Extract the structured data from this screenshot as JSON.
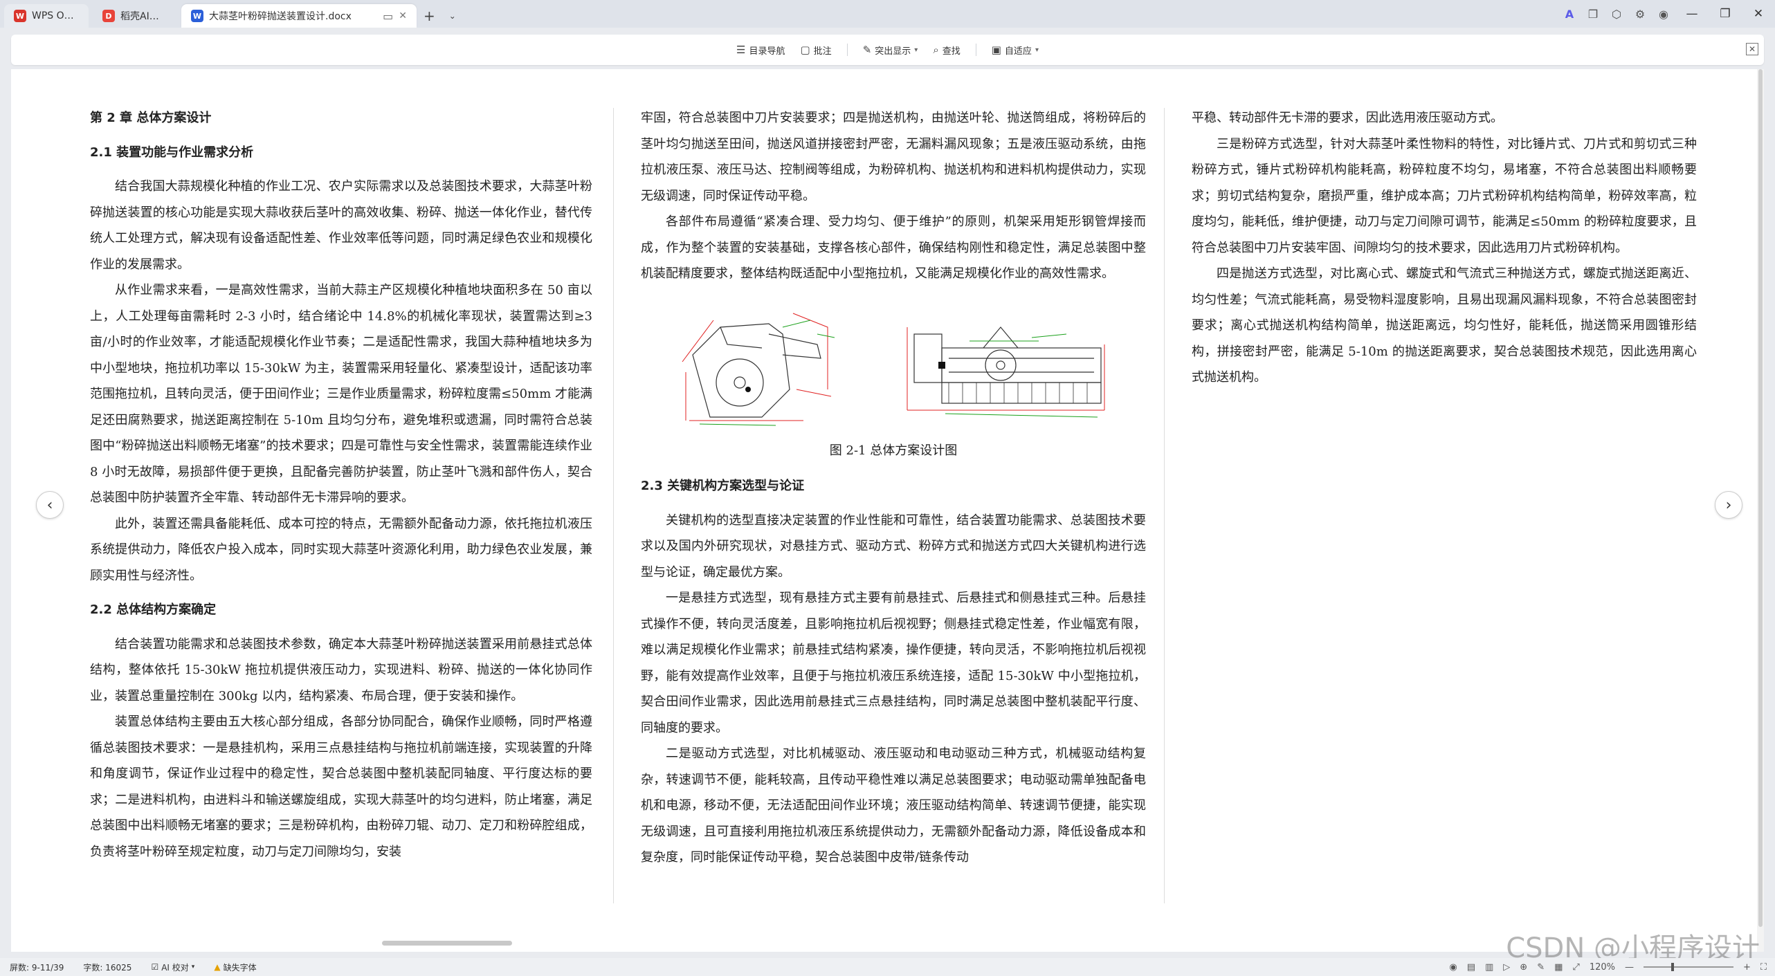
{
  "tabs": [
    {
      "label": "WPS Office",
      "logo_text": "W",
      "logo_color": "#d9342b"
    },
    {
      "label": "稻壳AI模板",
      "logo_text": "D",
      "logo_color": "#e8443a"
    },
    {
      "label": "大蒜茎叶粉碎抛送装置设计.docx",
      "logo_text": "W",
      "logo_color": "#2b5fd9"
    }
  ],
  "toolbar": {
    "nav_label": "目录导航",
    "comment_label": "批注",
    "highlight_label": "突出显示",
    "find_label": "查找",
    "fit_label": "自适应"
  },
  "doc": {
    "ch_title": "第 2 章  总体方案设计",
    "s21_title": "2.1  装置功能与作业需求分析",
    "p1": "结合我国大蒜规模化种植的作业工况、农户实际需求以及总装图技术要求，大蒜茎叶粉碎抛送装置的核心功能是实现大蒜收获后茎叶的高效收集、粉碎、抛送一体化作业，替代传统人工处理方式，解决现有设备适配性差、作业效率低等问题，同时满足绿色农业和规模化作业的发展需求。",
    "p2": "从作业需求来看，一是高效性需求，当前大蒜主产区规模化种植地块面积多在 50 亩以上，人工处理每亩需耗时 2-3 小时，结合绪论中 14.8%的机械化率现状，装置需达到≥3 亩/小时的作业效率，才能适配规模化作业节奏；二是适配性需求，我国大蒜种植地块多为中小型地块，拖拉机功率以 15-30kW 为主，装置需采用轻量化、紧凑型设计，适配该功率范围拖拉机，且转向灵活，便于田间作业；三是作业质量需求，粉碎粒度需≤50mm 才能满足还田腐熟要求，抛送距离控制在 5-10m 且均匀分布，避免堆积或遗漏，同时需符合总装图中“粉碎抛送出料顺畅无堵塞”的技术要求；四是可靠性与安全性需求，装置需能连续作业 8 小时无故障，易损部件便于更换，且配备完善防护装置，防止茎叶飞溅和部件伤人，契合总装图中防护装置齐全牢靠、转动部件无卡滞异响的要求。",
    "p3": "此外，装置还需具备能耗低、成本可控的特点，无需额外配备动力源，依托拖拉机液压系统提供动力，降低农户投入成本，同时实现大蒜茎叶资源化利用，助力绿色农业发展，兼顾实用性与经济性。",
    "s22_title": "2.2  总体结构方案确定",
    "p4": "结合装置功能需求和总装图技术参数，确定本大蒜茎叶粉碎抛送装置采用前悬挂式总体结构，整体依托 15-30kW 拖拉机提供液压动力，实现进料、粉碎、抛送的一体化协同作业，装置总重量控制在 300kg 以内，结构紧凑、布局合理，便于安装和操作。",
    "p5": "装置总体结构主要由五大核心部分组成，各部分协同配合，确保作业顺畅，同时严格遵循总装图技术要求：一是悬挂机构，采用三点悬挂结构与拖拉机前端连接，实现装置的升降和角度调节，保证作业过程中的稳定性，契合总装图中整机装配同轴度、平行度达标的要求；二是进料机构，由进料斗和输送螺旋组成，实现大蒜茎叶的均匀进料，防止堵塞，满足总装图中出料顺畅无堵塞的要求；三是粉碎机构，由粉碎刀辊、动刀、定刀和粉碎腔组成，负责将茎叶粉碎至规定粒度，动刀与定刀间隙均匀，安装",
    "p6": "牢固，符合总装图中刀片安装要求；四是抛送机构，由抛送叶轮、抛送筒组成，将粉碎后的茎叶均匀抛送至田间，抛送风道拼接密封严密，无漏料漏风现象；五是液压驱动系统，由拖拉机液压泵、液压马达、控制阀等组成，为粉碎机构、抛送机构和进料机构提供动力，实现无级调速，同时保证传动平稳。",
    "p7": "各部件布局遵循“紧凑合理、受力均匀、便于维护”的原则，机架采用矩形钢管焊接而成，作为整个装置的安装基础，支撑各核心部件，确保结构刚性和稳定性，满足总装图中整机装配精度要求，整体结构既适配中小型拖拉机，又能满足规模化作业的高效性需求。",
    "fig_caption": "图 2-1  总体方案设计图",
    "s23_title": "2.3  关键机构方案选型与论证",
    "p8": "关键机构的选型直接决定装置的作业性能和可靠性，结合装置功能需求、总装图技术要求以及国内外研究现状，对悬挂方式、驱动方式、粉碎方式和抛送方式四大关键机构进行选型与论证，确定最优方案。",
    "p9": "一是悬挂方式选型，现有悬挂方式主要有前悬挂式、后悬挂式和侧悬挂式三种。后悬挂式操作不便，转向灵活度差，且影响拖拉机后视视野；侧悬挂式稳定性差，作业幅宽有限，难以满足规模化作业需求；前悬挂式结构紧凑，操作便捷，转向灵活，不影响拖拉机后视视野，能有效提高作业效率，且便于与拖拉机液压系统连接，适配 15-30kW 中小型拖拉机，契合田间作业需求，因此选用前悬挂式三点悬挂结构，同时满足总装图中整机装配平行度、同轴度的要求。",
    "p10": "二是驱动方式选型，对比机械驱动、液压驱动和电动驱动三种方式，机械驱动结构复杂，转速调节不便，能耗较高，且传动平稳性难以满足总装图要求；电动驱动需单独配备电机和电源，移动不便，无法适配田间作业环境；液压驱动结构简单、转速调节便捷，能实现无级调速，且可直接利用拖拉机液压系统提供动力，无需额外配备动力源，降低设备成本和复杂度，同时能保证传动平稳，契合总装图中皮带/链条传动",
    "p11": "平稳、转动部件无卡滞的要求，因此选用液压驱动方式。",
    "p12": "三是粉碎方式选型，针对大蒜茎叶柔性物料的特性，对比锤片式、刀片式和剪切式三种粉碎方式，锤片式粉碎机构能耗高，粉碎粒度不均匀，易堵塞，不符合总装图出料顺畅要求；剪切式结构复杂，磨损严重，维护成本高；刀片式粉碎机构结构简单，粉碎效率高，粒度均匀，能耗低，维护便捷，动刀与定刀间隙可调节，能满足≤50mm 的粉碎粒度要求，且符合总装图中刀片安装牢固、间隙均匀的技术要求，因此选用刀片式粉碎机构。",
    "p13": "四是抛送方式选型，对比离心式、螺旋式和气流式三种抛送方式，螺旋式抛送距离近、均匀性差；气流式能耗高，易受物料湿度影响，且易出现漏风漏料现象，不符合总装图密封要求；离心式抛送机构结构简单，抛送距离远，均匀性好，能耗低，抛送筒采用圆锥形结构，拼接密封严密，能满足 5-10m 的抛送距离要求，契合总装图技术规范，因此选用离心式抛送机构。"
  },
  "status": {
    "page": "屏数: 9-11/39",
    "words": "字数: 16025",
    "ai": "AI 校对",
    "missing_font": "缺失字体",
    "zoom": "120%"
  },
  "watermark": "CSDN @小程序设计"
}
